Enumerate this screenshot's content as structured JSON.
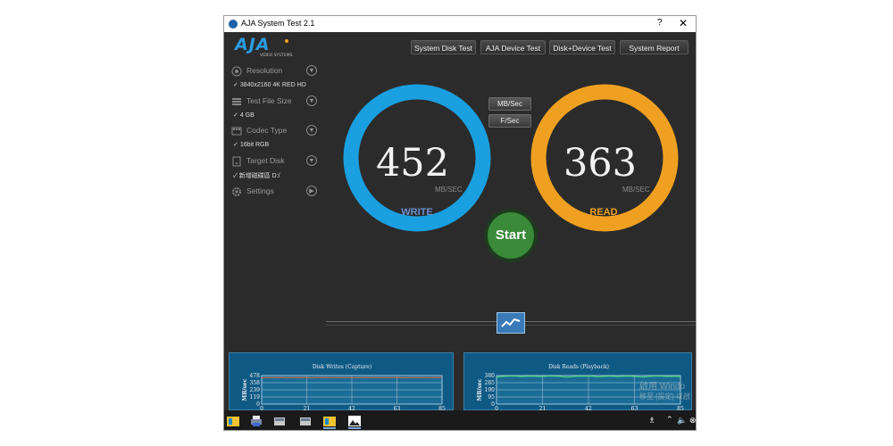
{
  "window": {
    "title": "AJA System Test 2.1",
    "help": "?",
    "close": "✕"
  },
  "logo": {
    "text": "AJA",
    "tagline": "VIDEO SYSTEMS"
  },
  "tabs": [
    "System Disk Test",
    "AJA Device Test",
    "Disk+Device Test",
    "System Report"
  ],
  "settings": [
    {
      "label": "Resolution",
      "value": "3840x2160 4K RED HD",
      "icon": "resolution-icon",
      "arrow": "down"
    },
    {
      "label": "Test File Size",
      "value": "4 GB",
      "icon": "file-size-icon",
      "arrow": "down"
    },
    {
      "label": "Codec Type",
      "value": "16bit RGB",
      "icon": "codec-icon",
      "arrow": "down"
    },
    {
      "label": "Target Disk",
      "value": "新增磁碟區 D:/",
      "icon": "disk-icon",
      "arrow": "down"
    },
    {
      "label": "Settings",
      "value": "",
      "icon": "gear-icon",
      "arrow": "right"
    }
  ],
  "check_mark": "✓",
  "units": {
    "mbsec": "MB/Sec",
    "fsec": "F/Sec"
  },
  "write": {
    "value": "452",
    "unit": "MB/SEC",
    "label": "WRITE",
    "color": "#1a9fe0",
    "label_color": "#6a8fd0"
  },
  "read": {
    "value": "363",
    "unit": "MB/SEC",
    "label": "READ",
    "color": "#f0a020",
    "label_color": "#f0a020"
  },
  "start": {
    "label": "Start"
  },
  "chart_data": [
    {
      "type": "line",
      "title": "Disk Writes (Capture)",
      "ylabel": "MB/sec",
      "yticks": [
        "478",
        "358",
        "239",
        "119",
        "0"
      ],
      "xticks": [
        "0",
        "21",
        "42",
        "63",
        "85"
      ],
      "xlim": [
        0,
        85
      ],
      "ylim": [
        0,
        478
      ],
      "series": [
        {
          "values": [
            440,
            445,
            443,
            446,
            442,
            444,
            447,
            443,
            441,
            445,
            446,
            442,
            444,
            443,
            445,
            440,
            444,
            446,
            442,
            445,
            443,
            444,
            446,
            441,
            444,
            445,
            443,
            442,
            446,
            444
          ],
          "color": "#e06a3a"
        }
      ]
    },
    {
      "type": "line",
      "title": "Disk Reads (Playback)",
      "ylabel": "MB/sec",
      "yticks": [
        "380",
        "285",
        "190",
        "95",
        "0"
      ],
      "xticks": [
        "0",
        "21",
        "42",
        "63",
        "85"
      ],
      "xlim": [
        0,
        85
      ],
      "ylim": [
        0,
        380
      ],
      "series": [
        {
          "values": [
            360,
            368,
            372,
            370,
            366,
            371,
            369,
            364,
            370,
            372,
            368,
            358,
            366,
            371,
            369,
            370,
            362,
            368,
            371,
            365,
            369,
            372,
            366,
            360,
            368,
            370,
            371,
            367,
            369,
            365
          ],
          "color": "#3ad86a"
        }
      ]
    }
  ],
  "watermark": {
    "line1": "啟用 Windo",
    "line2": "移至 [設定] 以啟"
  },
  "taskbar": {
    "icons": [
      "explorer-icon",
      "printer-icon",
      "disk-tool-icon",
      "disk-tool-icon",
      "explorer-icon",
      "photos-icon"
    ]
  }
}
